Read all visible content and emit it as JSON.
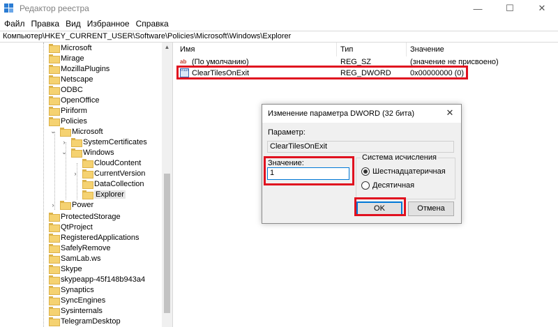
{
  "window": {
    "title": "Редактор реестра",
    "controls": {
      "minimize": "—",
      "maximize": "☐",
      "close": "✕"
    }
  },
  "menu": [
    "Файл",
    "Правка",
    "Вид",
    "Избранное",
    "Справка"
  ],
  "address": "Компьютер\\HKEY_CURRENT_USER\\Software\\Policies\\Microsoft\\Windows\\Explorer",
  "tree": [
    {
      "label": "Microsoft",
      "expander": ""
    },
    {
      "label": "Mirage",
      "expander": ""
    },
    {
      "label": "MozillaPlugins",
      "expander": ""
    },
    {
      "label": "Netscape",
      "expander": ""
    },
    {
      "label": "ODBC",
      "expander": ""
    },
    {
      "label": "OpenOffice",
      "expander": ""
    },
    {
      "label": "Piriform",
      "expander": ""
    },
    {
      "label": "Policies",
      "expander": ""
    },
    {
      "label": "Microsoft",
      "expander": "⌄"
    },
    {
      "label": "SystemCertificates",
      "expander": "›"
    },
    {
      "label": "Windows",
      "expander": "⌄"
    },
    {
      "label": "CloudContent",
      "expander": ""
    },
    {
      "label": "CurrentVersion",
      "expander": "›"
    },
    {
      "label": "DataCollection",
      "expander": ""
    },
    {
      "label": "Explorer",
      "expander": ""
    },
    {
      "label": "Power",
      "expander": "›"
    },
    {
      "label": "ProtectedStorage",
      "expander": ""
    },
    {
      "label": "QtProject",
      "expander": ""
    },
    {
      "label": "RegisteredApplications",
      "expander": ""
    },
    {
      "label": "SafelyRemove",
      "expander": ""
    },
    {
      "label": "SamLab.ws",
      "expander": ""
    },
    {
      "label": "Skype",
      "expander": ""
    },
    {
      "label": "skypeapp-45f148b943a4",
      "expander": ""
    },
    {
      "label": "Synaptics",
      "expander": ""
    },
    {
      "label": "SyncEngines",
      "expander": ""
    },
    {
      "label": "Sysinternals",
      "expander": ""
    },
    {
      "label": "TelegramDesktop",
      "expander": ""
    }
  ],
  "list": {
    "columns": {
      "name": "Имя",
      "type": "Тип",
      "value": "Значение"
    },
    "rows": [
      {
        "icon": "ab",
        "name": "(По умолчанию)",
        "type": "REG_SZ",
        "value": "(значение не присвоено)"
      },
      {
        "icon": "0110",
        "name": "ClearTilesOnExit",
        "type": "REG_DWORD",
        "value": "0x00000000 (0)"
      }
    ]
  },
  "dialog": {
    "title": "Изменение параметра DWORD (32 бита)",
    "close": "✕",
    "param_label": "Параметр:",
    "param_value": "ClearTilesOnExit",
    "value_label": "Значение:",
    "value": "1",
    "base_group": "Система исчисления",
    "hex_label": "Шестнадцатеричная",
    "dec_label": "Десятичная",
    "ok": "OK",
    "cancel": "Отмена"
  },
  "colors": {
    "highlight": "#e0111f",
    "accent": "#0078d7",
    "folder": "#f5d271"
  }
}
